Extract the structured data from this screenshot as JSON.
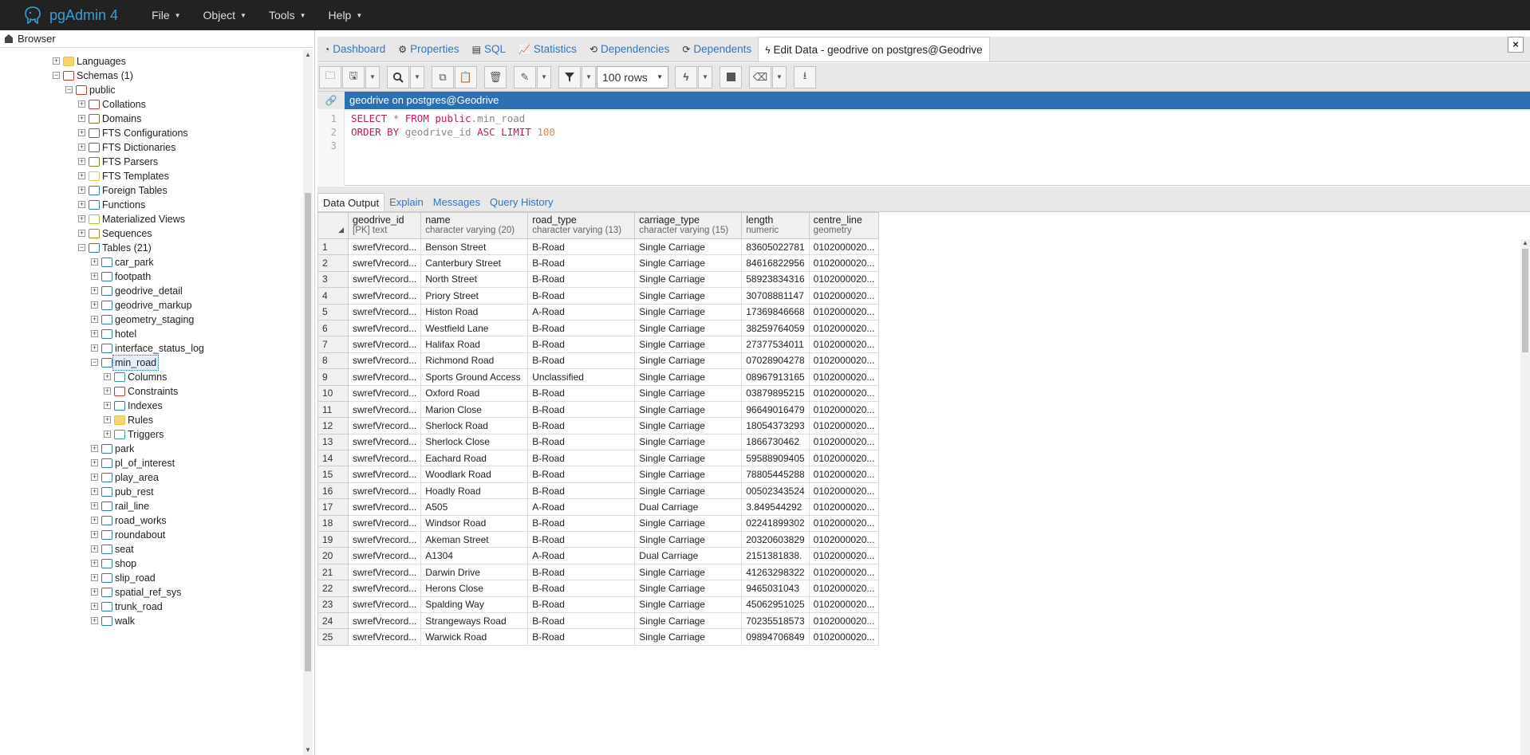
{
  "app": {
    "title": "pgAdmin 4",
    "menus": [
      "File",
      "Object",
      "Tools",
      "Help"
    ]
  },
  "browser": {
    "title": "Browser",
    "tree": [
      {
        "label": "Languages",
        "icon": "languages-icon",
        "depth": 0
      },
      {
        "label": "Schemas (1)",
        "icon": "schemas-icon",
        "depth": 0
      },
      {
        "label": "public",
        "icon": "schema-icon",
        "depth": 1
      },
      {
        "label": "Collations",
        "icon": "collations-icon",
        "depth": 2
      },
      {
        "label": "Domains",
        "icon": "domains-icon",
        "depth": 2
      },
      {
        "label": "FTS Configurations",
        "icon": "fts-configurations-icon",
        "depth": 2
      },
      {
        "label": "FTS Dictionaries",
        "icon": "fts-dictionaries-icon",
        "depth": 2
      },
      {
        "label": "FTS Parsers",
        "icon": "fts-parsers-icon",
        "depth": 2
      },
      {
        "label": "FTS Templates",
        "icon": "fts-templates-icon",
        "depth": 2
      },
      {
        "label": "Foreign Tables",
        "icon": "foreign-tables-icon",
        "depth": 2
      },
      {
        "label": "Functions",
        "icon": "functions-icon",
        "depth": 2
      },
      {
        "label": "Materialized Views",
        "icon": "materialized-views-icon",
        "depth": 2
      },
      {
        "label": "Sequences",
        "icon": "sequences-icon",
        "depth": 2
      },
      {
        "label": "Tables (21)",
        "icon": "tables-icon",
        "depth": 2
      },
      {
        "label": "car_park",
        "icon": "table-icon",
        "depth": 3
      },
      {
        "label": "footpath",
        "icon": "table-icon",
        "depth": 3
      },
      {
        "label": "geodrive_detail",
        "icon": "table-icon",
        "depth": 3
      },
      {
        "label": "geodrive_markup",
        "icon": "table-icon",
        "depth": 3
      },
      {
        "label": "geometry_staging",
        "icon": "table-icon",
        "depth": 3
      },
      {
        "label": "hotel",
        "icon": "table-icon",
        "depth": 3
      },
      {
        "label": "interface_status_log",
        "icon": "table-icon",
        "depth": 3
      },
      {
        "label": "min_road",
        "icon": "table-icon",
        "depth": 3,
        "selected": true
      },
      {
        "label": "Columns",
        "icon": "columns-icon",
        "depth": 4
      },
      {
        "label": "Constraints",
        "icon": "constraints-icon",
        "depth": 4
      },
      {
        "label": "Indexes",
        "icon": "indexes-icon",
        "depth": 4
      },
      {
        "label": "Rules",
        "icon": "rules-icon",
        "depth": 4
      },
      {
        "label": "Triggers",
        "icon": "triggers-icon",
        "depth": 4
      },
      {
        "label": "park",
        "icon": "table-icon",
        "depth": 3
      },
      {
        "label": "pl_of_interest",
        "icon": "table-icon",
        "depth": 3
      },
      {
        "label": "play_area",
        "icon": "table-icon",
        "depth": 3
      },
      {
        "label": "pub_rest",
        "icon": "table-icon",
        "depth": 3
      },
      {
        "label": "rail_line",
        "icon": "table-icon",
        "depth": 3
      },
      {
        "label": "road_works",
        "icon": "table-icon",
        "depth": 3
      },
      {
        "label": "roundabout",
        "icon": "table-icon",
        "depth": 3
      },
      {
        "label": "seat",
        "icon": "table-icon",
        "depth": 3
      },
      {
        "label": "shop",
        "icon": "table-icon",
        "depth": 3
      },
      {
        "label": "slip_road",
        "icon": "table-icon",
        "depth": 3
      },
      {
        "label": "spatial_ref_sys",
        "icon": "table-icon",
        "depth": 3
      },
      {
        "label": "trunk_road",
        "icon": "table-icon",
        "depth": 3
      },
      {
        "label": "walk",
        "icon": "table-icon",
        "depth": 3
      }
    ]
  },
  "tabs": [
    {
      "label": "Dashboard",
      "icon": "dashboard-icon"
    },
    {
      "label": "Properties",
      "icon": "properties-icon"
    },
    {
      "label": "SQL",
      "icon": "sql-icon"
    },
    {
      "label": "Statistics",
      "icon": "statistics-icon"
    },
    {
      "label": "Dependencies",
      "icon": "dependencies-icon"
    },
    {
      "label": "Dependents",
      "icon": "dependents-icon"
    },
    {
      "label": "Edit Data - geodrive on postgres@Geodrive",
      "icon": "lightning-icon",
      "active": true
    }
  ],
  "toolbar": {
    "rows_limit": "100 rows"
  },
  "connection": {
    "label": "geodrive on postgres@Geodrive"
  },
  "editor": {
    "line_numbers": [
      "1",
      "2",
      "3"
    ],
    "line1": {
      "kw1": "SELECT",
      "star": "*",
      "kw2": "FROM",
      "schema": "public",
      "dot": ".",
      "table": "min_road"
    },
    "line2": {
      "kw1": "ORDER BY",
      "col": "geodrive_id",
      "kw2": "ASC",
      "kw3": "LIMIT",
      "num": "100"
    }
  },
  "result_tabs": [
    "Data Output",
    "Explain",
    "Messages",
    "Query History"
  ],
  "grid": {
    "columns": [
      {
        "name": "geodrive_id",
        "type": "[PK] text"
      },
      {
        "name": "name",
        "type": "character varying (20)"
      },
      {
        "name": "road_type",
        "type": "character varying (13)"
      },
      {
        "name": "carriage_type",
        "type": "character varying (15)"
      },
      {
        "name": "length",
        "type": "numeric"
      },
      {
        "name": "centre_line",
        "type": "geometry"
      }
    ],
    "rows": [
      [
        "1",
        "swrefVrecord...",
        "Benson Street",
        "B-Road",
        "Single Carriage",
        "83605022781",
        "0102000020..."
      ],
      [
        "2",
        "swrefVrecord...",
        "Canterbury Street",
        "B-Road",
        "Single Carriage",
        "84616822956",
        "0102000020..."
      ],
      [
        "3",
        "swrefVrecord...",
        "North Street",
        "B-Road",
        "Single Carriage",
        "58923834316",
        "0102000020..."
      ],
      [
        "4",
        "swrefVrecord...",
        "Priory Street",
        "B-Road",
        "Single Carriage",
        "30708881147",
        "0102000020..."
      ],
      [
        "5",
        "swrefVrecord...",
        "Histon Road",
        "A-Road",
        "Single Carriage",
        "17369846668",
        "0102000020..."
      ],
      [
        "6",
        "swrefVrecord...",
        "Westfield Lane",
        "B-Road",
        "Single Carriage",
        "38259764059",
        "0102000020..."
      ],
      [
        "7",
        "swrefVrecord...",
        "Halifax Road",
        "B-Road",
        "Single Carriage",
        "27377534011",
        "0102000020..."
      ],
      [
        "8",
        "swrefVrecord...",
        "Richmond Road",
        "B-Road",
        "Single Carriage",
        "07028904278",
        "0102000020..."
      ],
      [
        "9",
        "swrefVrecord...",
        "Sports Ground Access",
        "Unclassified",
        "Single Carriage",
        "08967913165",
        "0102000020..."
      ],
      [
        "10",
        "swrefVrecord...",
        "Oxford Road",
        "B-Road",
        "Single Carriage",
        "03879895215",
        "0102000020..."
      ],
      [
        "11",
        "swrefVrecord...",
        "Marion Close",
        "B-Road",
        "Single Carriage",
        "96649016479",
        "0102000020..."
      ],
      [
        "12",
        "swrefVrecord...",
        "Sherlock Road",
        "B-Road",
        "Single Carriage",
        "18054373293",
        "0102000020..."
      ],
      [
        "13",
        "swrefVrecord...",
        "Sherlock Close",
        "B-Road",
        "Single Carriage",
        "1866730462",
        "0102000020..."
      ],
      [
        "14",
        "swrefVrecord...",
        "Eachard Road",
        "B-Road",
        "Single Carriage",
        "59588909405",
        "0102000020..."
      ],
      [
        "15",
        "swrefVrecord...",
        "Woodlark Road",
        "B-Road",
        "Single Carriage",
        "78805445288",
        "0102000020..."
      ],
      [
        "16",
        "swrefVrecord...",
        "Hoadly Road",
        "B-Road",
        "Single Carriage",
        "00502343524",
        "0102000020..."
      ],
      [
        "17",
        "swrefVrecord...",
        "A505",
        "A-Road",
        "Dual Carriage",
        "3.849544292",
        "0102000020..."
      ],
      [
        "18",
        "swrefVrecord...",
        "Windsor Road",
        "B-Road",
        "Single Carriage",
        "02241899302",
        "0102000020..."
      ],
      [
        "19",
        "swrefVrecord...",
        "Akeman Street",
        "B-Road",
        "Single Carriage",
        "20320603829",
        "0102000020..."
      ],
      [
        "20",
        "swrefVrecord...",
        "A1304",
        "A-Road",
        "Dual Carriage",
        ".2151381838",
        "0102000020..."
      ],
      [
        "21",
        "swrefVrecord...",
        "Darwin Drive",
        "B-Road",
        "Single Carriage",
        "41263298322",
        "0102000020..."
      ],
      [
        "22",
        "swrefVrecord...",
        "Herons Close",
        "B-Road",
        "Single Carriage",
        "9465031043",
        "0102000020..."
      ],
      [
        "23",
        "swrefVrecord...",
        "Spalding Way",
        "B-Road",
        "Single Carriage",
        "45062951025",
        "0102000020..."
      ],
      [
        "24",
        "swrefVrecord...",
        "Strangeways Road",
        "B-Road",
        "Single Carriage",
        "70235518573",
        "0102000020..."
      ],
      [
        "25",
        "swrefVrecord...",
        "Warwick Road",
        "B-Road",
        "Single Carriage",
        "09894706849",
        "0102000020..."
      ]
    ]
  },
  "colors": {
    "navbar": "#222222",
    "brand": "#3a9fd6",
    "connection_bar": "#2d6fb0",
    "link": "#2c76c7",
    "keyword": "#c2185b"
  }
}
